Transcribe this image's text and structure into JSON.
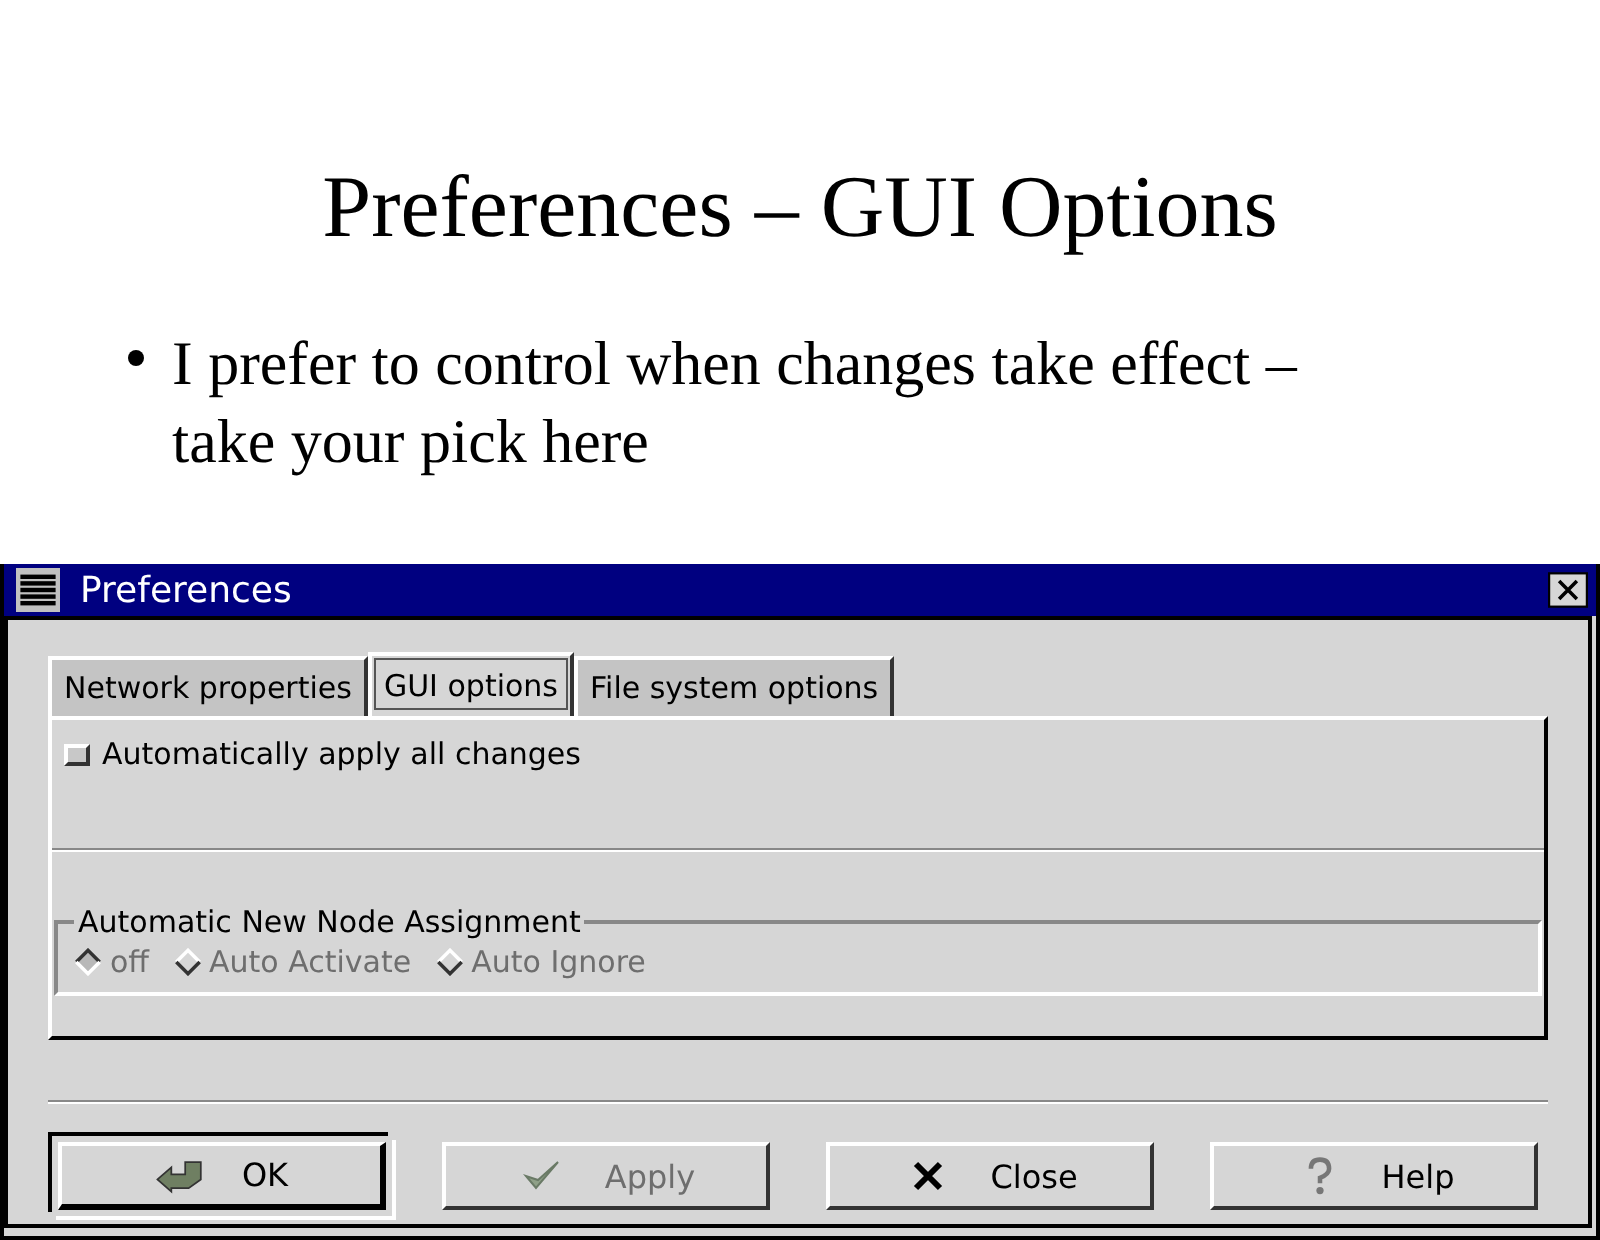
{
  "slide": {
    "title": "Preferences – GUI Options",
    "bullets": [
      "I prefer to control when changes take effect – take your pick here"
    ]
  },
  "window": {
    "title": "Preferences"
  },
  "tabs": [
    {
      "label": "Network properties",
      "selected": false
    },
    {
      "label": "GUI options",
      "selected": true
    },
    {
      "label": "File system options",
      "selected": false
    }
  ],
  "checkbox": {
    "label": "Automatically apply all changes",
    "checked": false
  },
  "group": {
    "label": "Automatic New Node Assignment",
    "disabled": true,
    "options": [
      {
        "label": "off",
        "selected": true
      },
      {
        "label": "Auto Activate",
        "selected": false
      },
      {
        "label": "Auto Ignore",
        "selected": false
      }
    ]
  },
  "buttons": [
    {
      "label": "OK",
      "kind": "ok",
      "disabled": false,
      "default": true
    },
    {
      "label": "Apply",
      "kind": "apply",
      "disabled": true,
      "default": false
    },
    {
      "label": "Close",
      "kind": "close",
      "disabled": false,
      "default": false
    },
    {
      "label": "Help",
      "kind": "help",
      "disabled": false,
      "default": false
    }
  ]
}
